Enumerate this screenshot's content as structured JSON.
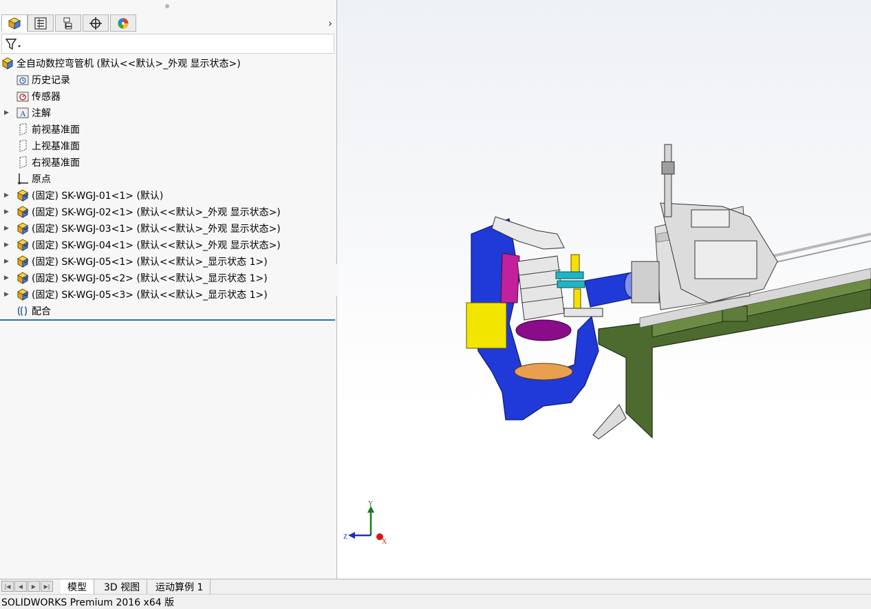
{
  "feature_manager": {
    "tabs": [
      "feature-manager",
      "property-manager",
      "configuration-manager",
      "dimxpert-manager",
      "display-manager"
    ],
    "tree": [
      {
        "label": "全自动数控弯管机  (默认<<默认>_外观 显示状态>)",
        "icon": "assembly-icon",
        "level": 0,
        "expandable": false
      },
      {
        "label": "历史记录",
        "icon": "history-icon",
        "level": 1,
        "expandable": false
      },
      {
        "label": "传感器",
        "icon": "sensor-icon",
        "level": 1,
        "expandable": false
      },
      {
        "label": "注解",
        "icon": "annotation-icon",
        "level": 1,
        "expandable": true
      },
      {
        "label": "前视基准面",
        "icon": "plane-icon",
        "level": 1,
        "expandable": false
      },
      {
        "label": "上视基准面",
        "icon": "plane-icon",
        "level": 1,
        "expandable": false
      },
      {
        "label": "右视基准面",
        "icon": "plane-icon",
        "level": 1,
        "expandable": false
      },
      {
        "label": "原点",
        "icon": "origin-icon",
        "level": 1,
        "expandable": false
      },
      {
        "label": "(固定) SK-WGJ-01<1> (默认)",
        "icon": "subassembly-icon",
        "level": 1,
        "expandable": true
      },
      {
        "label": "(固定) SK-WGJ-02<1> (默认<<默认>_外观 显示状态>)",
        "icon": "subassembly-icon",
        "level": 1,
        "expandable": true
      },
      {
        "label": "(固定) SK-WGJ-03<1> (默认<<默认>_外观 显示状态>)",
        "icon": "subassembly-icon",
        "level": 1,
        "expandable": true
      },
      {
        "label": "(固定) SK-WGJ-04<1> (默认<<默认>_外观 显示状态>)",
        "icon": "subassembly-icon",
        "level": 1,
        "expandable": true
      },
      {
        "label": "(固定) SK-WGJ-05<1> (默认<<默认>_显示状态 1>)",
        "icon": "subassembly-icon",
        "level": 1,
        "expandable": true
      },
      {
        "label": "(固定) SK-WGJ-05<2> (默认<<默认>_显示状态 1>)",
        "icon": "subassembly-icon",
        "level": 1,
        "expandable": true
      },
      {
        "label": "(固定) SK-WGJ-05<3> (默认<<默认>_显示状态 1>)",
        "icon": "subassembly-icon",
        "level": 1,
        "expandable": true
      },
      {
        "label": "配合",
        "icon": "mates-icon",
        "level": 1,
        "expandable": false
      }
    ]
  },
  "triad": {
    "x": "X",
    "y": "Y",
    "z": "Z"
  },
  "bottom_tabs": [
    "模型",
    "3D 视图",
    "运动算例 1"
  ],
  "active_bottom_tab": "模型",
  "status_bar": {
    "text": "SOLIDWORKS Premium 2016 x64 版"
  },
  "colors": {
    "accent": "#2e6cbf",
    "frame_green": "#4d6b2e",
    "machine_blue": "#1f3ad8",
    "highlight_yellow": "#f2e600"
  }
}
